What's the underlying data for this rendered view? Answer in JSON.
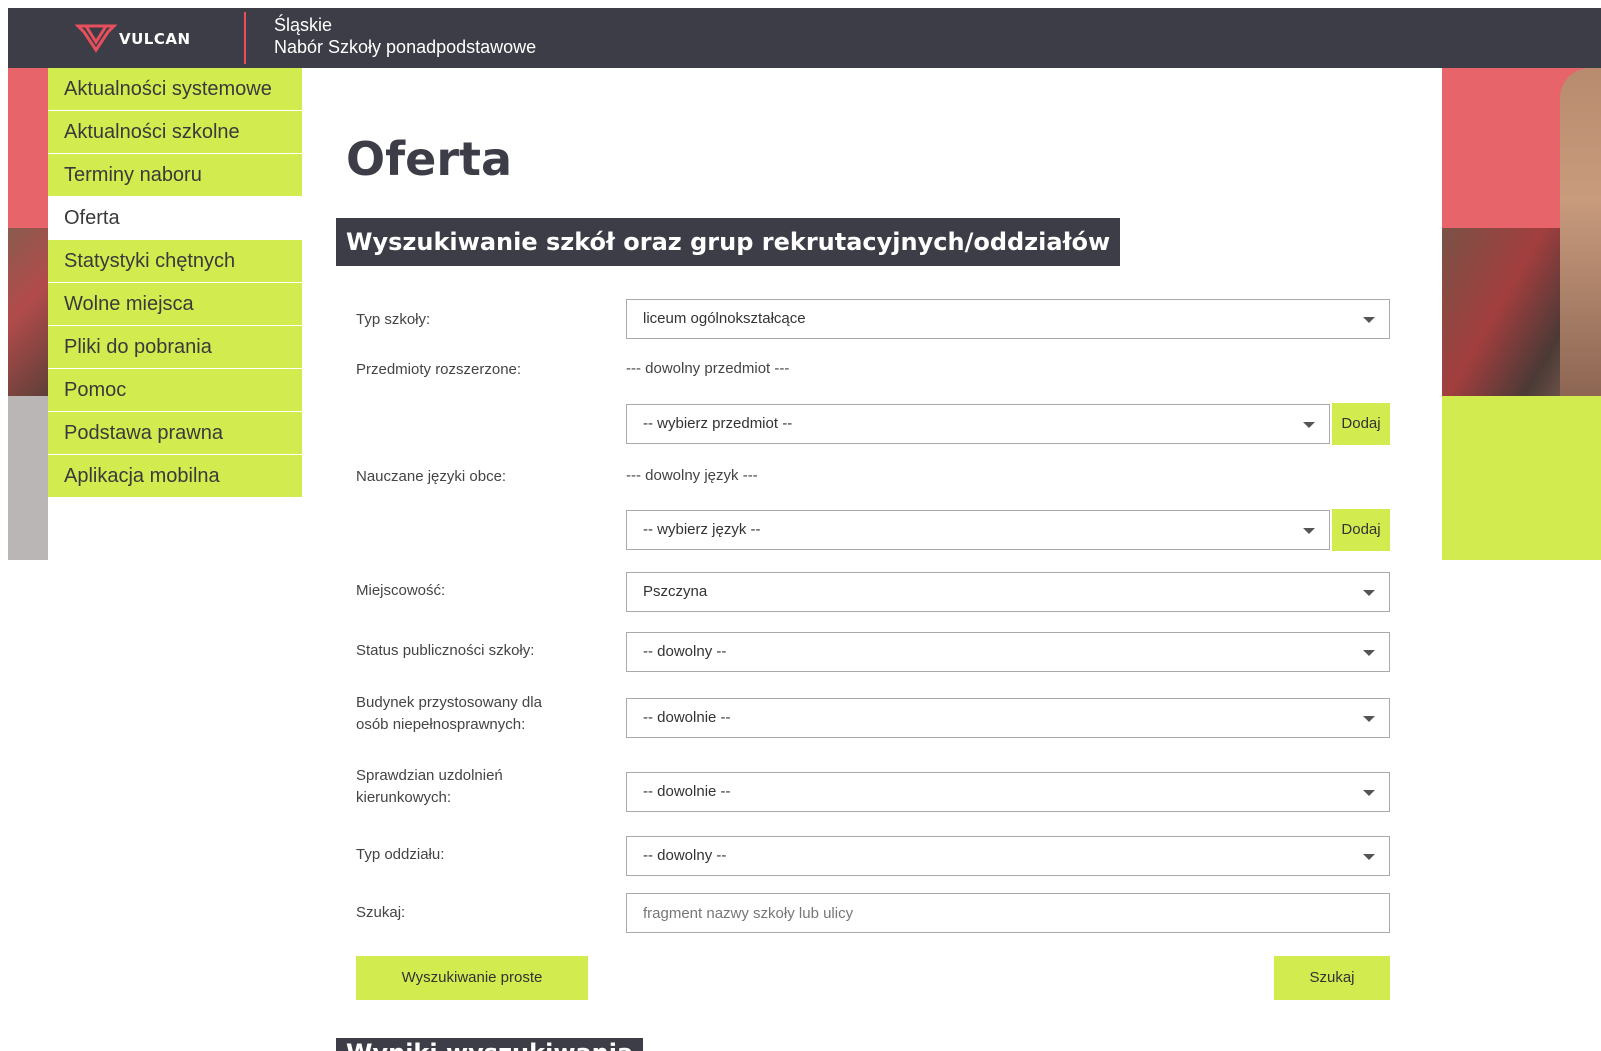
{
  "header": {
    "logo_text": "VULCAN",
    "region": "Śląskie",
    "subtitle": "Nabór Szkoły ponadpodstawowe"
  },
  "menu": {
    "items": [
      {
        "label": "Aktualności systemowe"
      },
      {
        "label": "Aktualności szkolne"
      },
      {
        "label": "Terminy naboru"
      },
      {
        "label": "Oferta"
      },
      {
        "label": "Statystyki chętnych"
      },
      {
        "label": "Wolne miejsca"
      },
      {
        "label": "Pliki do pobrania"
      },
      {
        "label": "Pomoc"
      },
      {
        "label": "Podstawa prawna"
      },
      {
        "label": "Aplikacja mobilna"
      }
    ],
    "active": "Oferta"
  },
  "page": {
    "title": "Oferta",
    "search_heading": "Wyszukiwanie szkół oraz grup rekrutacyjnych/oddziałów",
    "results_heading": "Wyniki wyszukiwania"
  },
  "form": {
    "school_type": {
      "label": "Typ szkoły:",
      "value": "liceum ogólnokształcące"
    },
    "subjects": {
      "label": "Przedmioty rozszerzone:",
      "current": "--- dowolny przedmiot ---",
      "select_value": "-- wybierz przedmiot --",
      "add_label": "Dodaj"
    },
    "languages": {
      "label": "Nauczane języki obce:",
      "current": "--- dowolny język ---",
      "select_value": "-- wybierz język --",
      "add_label": "Dodaj"
    },
    "town": {
      "label": "Miejscowość:",
      "value": "Pszczyna"
    },
    "public_status": {
      "label": "Status publiczności szkoły:",
      "value": "-- dowolny --"
    },
    "accessible": {
      "label_line1": "Budynek przystosowany dla",
      "label_line2": "osób niepełnosprawnych:",
      "value": "-- dowolnie --"
    },
    "aptitude_test": {
      "label_line1": "Sprawdzian uzdolnień",
      "label_line2": "kierunkowych:",
      "value": "-- dowolnie --"
    },
    "class_type": {
      "label": "Typ oddziału:",
      "value": "-- dowolny --"
    },
    "search": {
      "label": "Szukaj:",
      "placeholder": "fragment nazwy szkoły lub ulicy"
    },
    "simple_search_label": "Wyszukiwanie proste",
    "submit_label": "Szukaj"
  },
  "colors": {
    "topbar": "#3d3d47",
    "accent_green": "#d2eb4e",
    "accent_red": "#e8646b"
  }
}
